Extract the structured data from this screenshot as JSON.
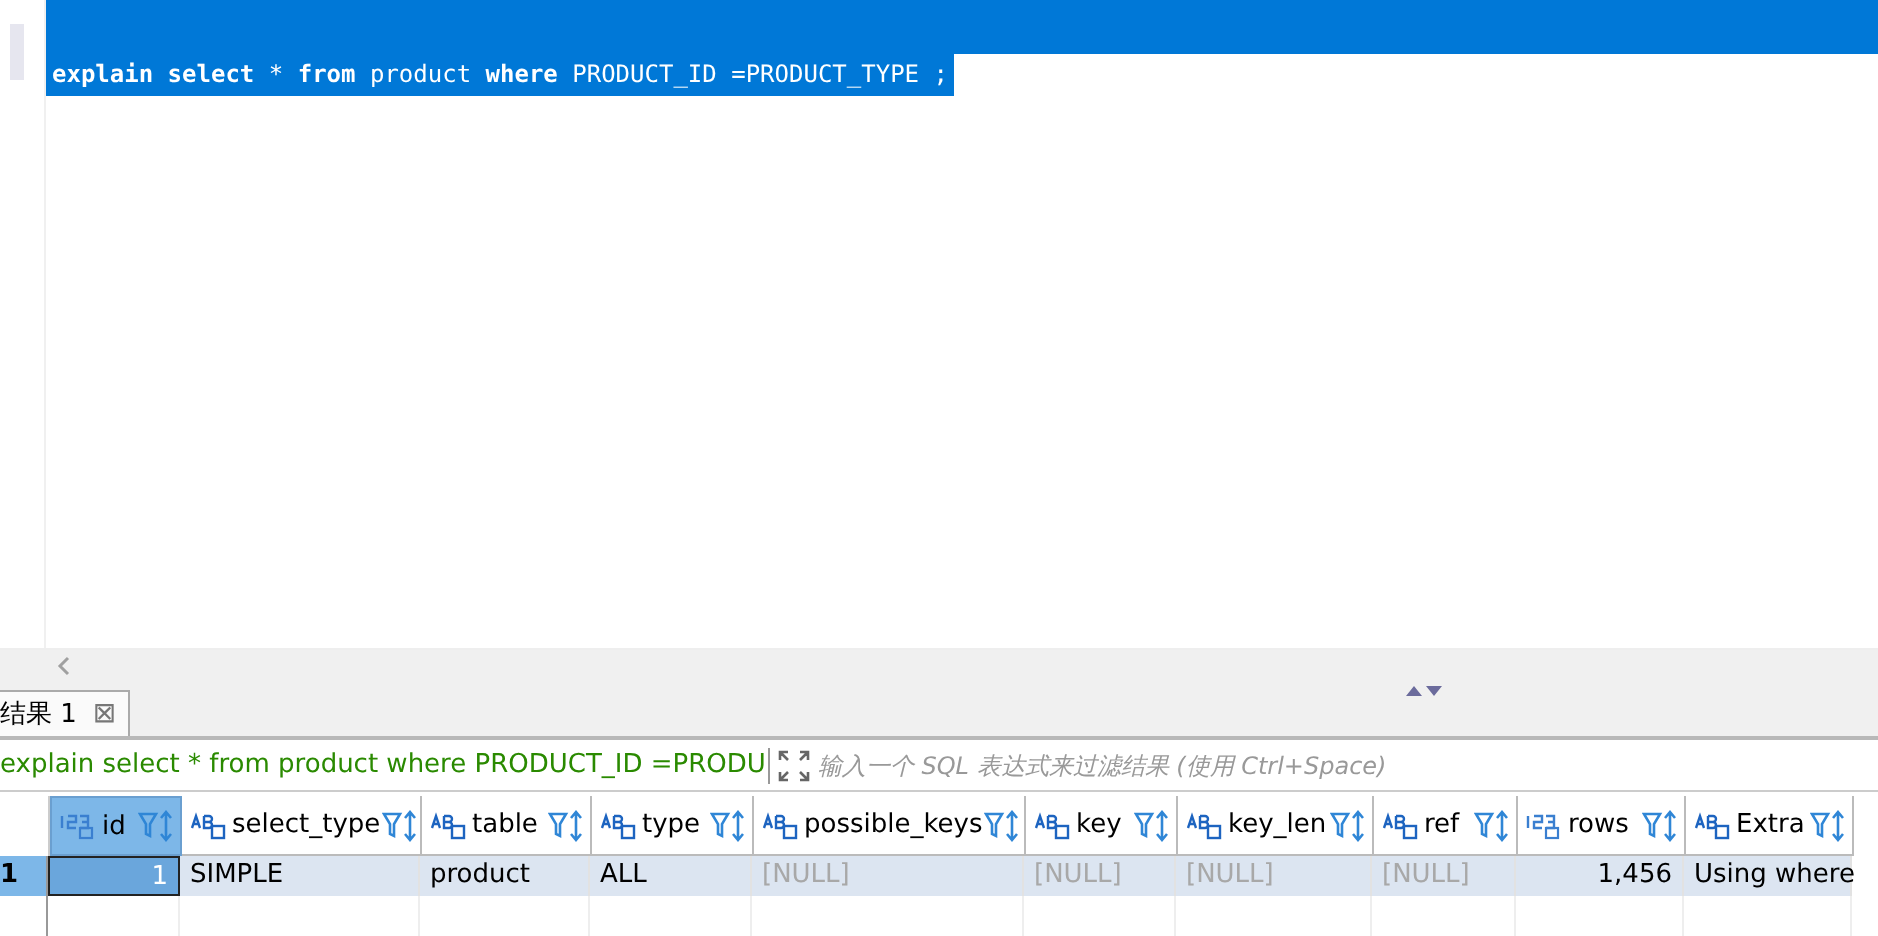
{
  "editor": {
    "lines": [
      {
        "selected": true
      },
      {
        "text": "**explain select** * **from** product **where** PRODUCT_ID =PRODUCT_TYPE  ;",
        "selected": true
      }
    ]
  },
  "results_tab": {
    "label": "结果 1",
    "close": "⊠",
    "selected": true
  },
  "filter": {
    "value": "explain select * from product where PRODUCT_ID =PRODU",
    "placeholder": "输入一个 SQL 表达式来过滤结果 (使用 Ctrl+Space)"
  },
  "table": {
    "columns": [
      {
        "name": "id",
        "kind": "number",
        "selected": true
      },
      {
        "name": "select_type",
        "kind": "text",
        "selected": false
      },
      {
        "name": "table",
        "kind": "text",
        "selected": false
      },
      {
        "name": "type",
        "kind": "text",
        "selected": false
      },
      {
        "name": "possible_keys",
        "kind": "text",
        "selected": false
      },
      {
        "name": "key",
        "kind": "text",
        "selected": false
      },
      {
        "name": "key_len",
        "kind": "text",
        "selected": false
      },
      {
        "name": "ref",
        "kind": "text",
        "selected": false
      },
      {
        "name": "rows",
        "kind": "number",
        "selected": false
      },
      {
        "name": "Extra",
        "kind": "text",
        "selected": false
      }
    ],
    "rows": [
      {
        "number": "1",
        "selected": true,
        "cells": [
          {
            "text": "1",
            "null": false,
            "selected": true
          },
          {
            "text": "SIMPLE",
            "null": false,
            "selected": false
          },
          {
            "text": "product",
            "null": false,
            "selected": false
          },
          {
            "text": "ALL",
            "null": false,
            "selected": false
          },
          {
            "text": "[NULL]",
            "null": true,
            "selected": false
          },
          {
            "text": "[NULL]",
            "null": true,
            "selected": false
          },
          {
            "text": "[NULL]",
            "null": true,
            "selected": false
          },
          {
            "text": "[NULL]",
            "null": true,
            "selected": false
          },
          {
            "text": "1,456",
            "null": false,
            "selected": false
          },
          {
            "text": "Using where",
            "null": false,
            "selected": false
          }
        ]
      }
    ]
  }
}
